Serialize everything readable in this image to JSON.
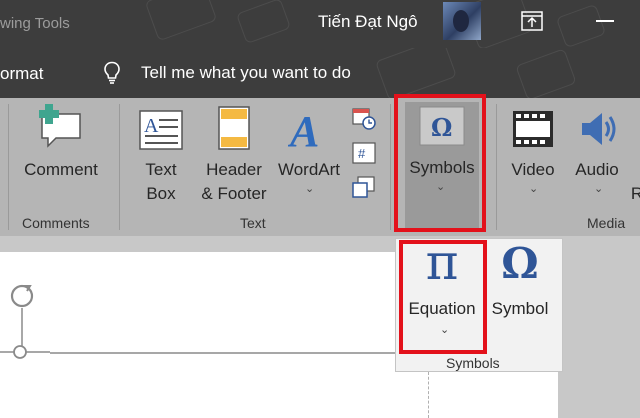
{
  "titlebar": {
    "app_context": "wing Tools",
    "user_name": "Tiến Đạt Ngô"
  },
  "tabs": {
    "format_label": "ormat",
    "tell_me": "Tell me what you want to do"
  },
  "ribbon": {
    "comment": {
      "label": "Comment"
    },
    "comments_group": "Comments",
    "text_box": {
      "line1": "Text",
      "line2": "Box"
    },
    "header_footer": {
      "line1": "Header",
      "line2": "& Footer"
    },
    "wordart": {
      "label": "WordArt",
      "chevron": "⌄"
    },
    "text_group": "Text",
    "symbols": {
      "label": "Symbols",
      "chevron": "⌄",
      "glyph": "Ω"
    },
    "video": {
      "label": "Video",
      "chevron": "⌄"
    },
    "audio": {
      "label": "Audio",
      "chevron": "⌄"
    },
    "next_partial": "R",
    "media_group": "Media"
  },
  "symbols_dropdown": {
    "equation": {
      "glyph": "π",
      "label": "Equation",
      "chevron": "⌄"
    },
    "symbol": {
      "glyph": "Ω",
      "label": "Symbol"
    },
    "group_label": "Symbols"
  },
  "colors": {
    "titlebar": "#3d3d3d",
    "ribbon": "#b5b5b5",
    "highlight_red": "#e3111b",
    "accent_blue": "#2f5597"
  }
}
